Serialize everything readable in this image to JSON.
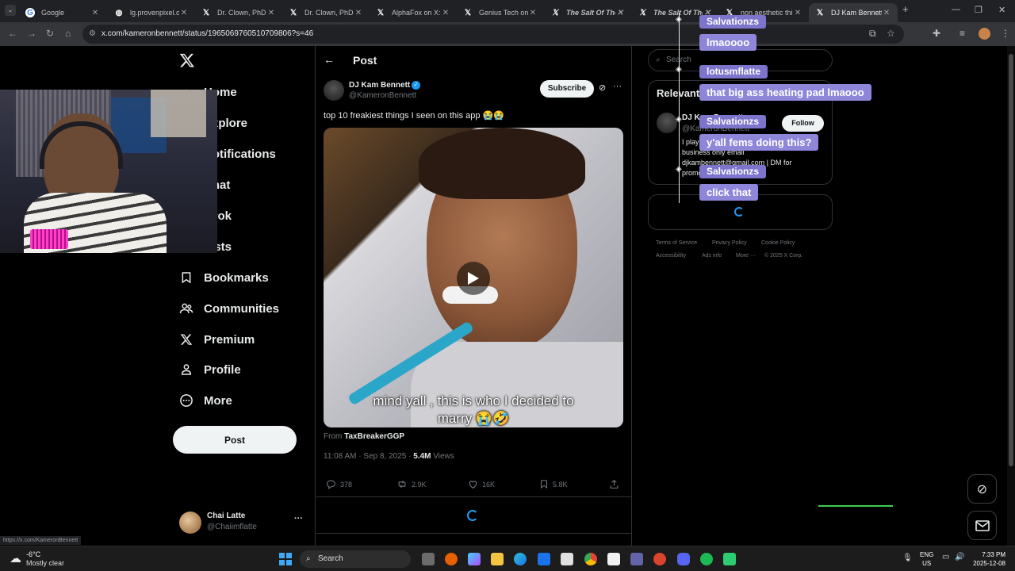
{
  "browser": {
    "tabs": [
      {
        "title": "Google",
        "icon": "google-icon",
        "active": false
      },
      {
        "title": "lg.provenpixel.co",
        "icon": "globe-icon",
        "active": false
      },
      {
        "title": "Dr. Clown, PhD o",
        "icon": "x-logo-icon",
        "active": false
      },
      {
        "title": "Dr. Clown, PhD o",
        "icon": "x-logo-icon",
        "active": false
      },
      {
        "title": "AlphaFox on X: \"",
        "icon": "x-logo-icon",
        "active": false
      },
      {
        "title": "Genius Tech on X",
        "icon": "x-logo-icon",
        "active": false
      },
      {
        "title": "The Salt Of The",
        "icon": "x-logo-icon",
        "active": false
      },
      {
        "title": "The Salt Of The",
        "icon": "x-logo-icon",
        "active": false
      },
      {
        "title": "non aesthetic thi",
        "icon": "x-logo-icon",
        "active": false
      },
      {
        "title": "DJ Kam Bennett o",
        "icon": "x-logo-icon",
        "active": true
      }
    ],
    "url": "x.com/kameronbennett/status/1965069760510709806?s=46",
    "status_url": "https://x.com/KameronBennett"
  },
  "sidebar": {
    "items": [
      {
        "label": "Home",
        "icon": "home-icon"
      },
      {
        "label": "Explore",
        "icon": "search-icon"
      },
      {
        "label": "Notifications",
        "icon": "bell-icon"
      },
      {
        "label": "Chat",
        "icon": "chat-icon"
      },
      {
        "label": "Grok",
        "icon": "grok-icon"
      },
      {
        "label": "Lists",
        "icon": "list-icon"
      },
      {
        "label": "Bookmarks",
        "icon": "bookmark-icon"
      },
      {
        "label": "Communities",
        "icon": "communities-icon"
      },
      {
        "label": "Premium",
        "icon": "x-logo-icon"
      },
      {
        "label": "Profile",
        "icon": "profile-icon"
      },
      {
        "label": "More",
        "icon": "more-circle-icon"
      }
    ],
    "post_button": "Post",
    "account": {
      "name": "Chai Latte",
      "handle": "@Chaiimflatte"
    }
  },
  "post": {
    "header": "Post",
    "author": "DJ Kam Bennett",
    "handle": "@KameronBennett",
    "subscribe": "Subscribe",
    "text": "top 10 freakiest things I seen on this app 😭😭",
    "caption_line1": "mind yall , this is who I decided to",
    "caption_line2": "marry 😭🤣",
    "from_label": "From",
    "from_account": "TaxBreakerGGP",
    "timestamp": "11:08 AM · Sep 8, 2025 ·",
    "views_count": "5.4M",
    "views_label": "Views",
    "replies": "378",
    "reposts": "2.9K",
    "likes": "16K",
    "bookmarks": "5.8K"
  },
  "right": {
    "search_placeholder": "Search",
    "relevant_title": "Relevant people",
    "person_name": "DJ Kam Bennett",
    "person_handle": "@KameronBennett",
    "follow": "Follow",
    "bio_line1": "I play",
    "bio_line2": "business only email",
    "bio_line3": "djkambennett@gmail.com | DM for",
    "bio_line4": "promo",
    "footer": [
      "Terms of Service",
      "Privacy Policy",
      "Cookie Policy",
      "Accessibility",
      "Ads info",
      "More ···",
      "© 2025 X Corp."
    ]
  },
  "chat_overlay": [
    {
      "name": "Salvationzs",
      "message": "lmaoooo"
    },
    {
      "name": "lotusmflatte",
      "message": "that big ass heating pad lmaooo"
    },
    {
      "name": "Salvationzs",
      "message": "y'all fems doing this?"
    },
    {
      "name": "Salvationzs",
      "message": "click that"
    }
  ],
  "taskbar": {
    "temperature": "-6°C",
    "weather": "Mostly clear",
    "search": "Search",
    "lang1": "ENG",
    "lang2": "US",
    "time": "7:33 PM",
    "date": "2025-12-08"
  },
  "colors": {
    "accent": "#1d9bf0",
    "overlay": "#8e86d8",
    "verified": "#1d9bf0"
  }
}
